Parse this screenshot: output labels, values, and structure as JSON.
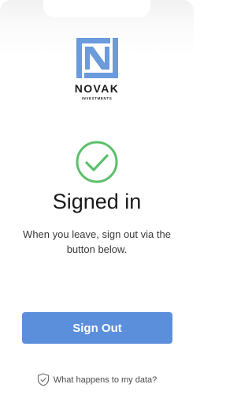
{
  "brand": {
    "name": "NOVAK",
    "subtitle": "INVESTMENTS",
    "logo_color": "#6a9bdc"
  },
  "status": {
    "icon": "checkmark-circle-icon",
    "icon_color": "#5cbf6a",
    "title": "Signed in",
    "message": "When you leave, sign out via the button below."
  },
  "actions": {
    "sign_out_label": "Sign Out",
    "sign_out_color": "#5b8fdc"
  },
  "footer": {
    "icon": "shield-check-icon",
    "link_text": "What happens to my data?"
  }
}
